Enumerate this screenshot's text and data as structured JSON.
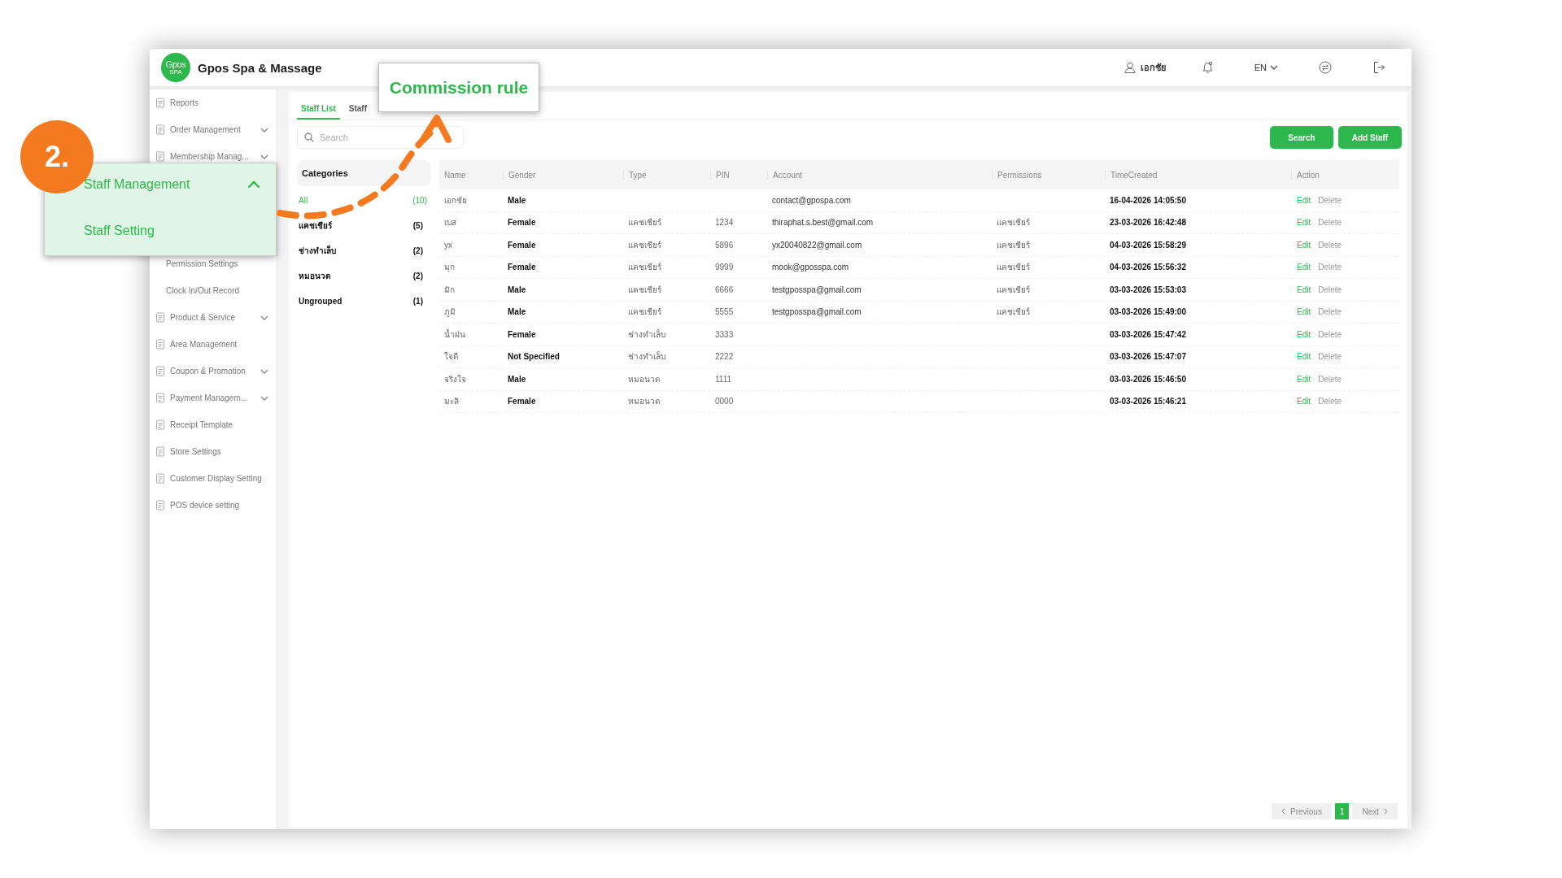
{
  "header": {
    "logo_text": "Gpos",
    "logo_sub": "SPA",
    "brand": "Gpos Spa & Massage",
    "user": "เอกชัย",
    "language": "EN"
  },
  "sidebar": {
    "items_top": [
      {
        "label": "Reports",
        "kind": "item",
        "expandable": false
      },
      {
        "label": "Order Management",
        "kind": "item",
        "expandable": true
      },
      {
        "label": "Membership Manag...",
        "kind": "item",
        "expandable": true
      }
    ],
    "items_bottom": [
      {
        "label": "Permission Settings",
        "kind": "sub",
        "expandable": false
      },
      {
        "label": "Clock In/Out Record",
        "kind": "sub",
        "expandable": false
      },
      {
        "label": "Product & Service",
        "kind": "item",
        "expandable": true
      },
      {
        "label": "Area Management",
        "kind": "item",
        "expandable": false
      },
      {
        "label": "Coupon & Promotion",
        "kind": "item",
        "expandable": true
      },
      {
        "label": "Payment Managem...",
        "kind": "item",
        "expandable": true
      },
      {
        "label": "Receipt Template",
        "kind": "item",
        "expandable": false
      },
      {
        "label": "Store Settings",
        "kind": "item",
        "expandable": false
      },
      {
        "label": "Customer Display Setting",
        "kind": "item",
        "expandable": false
      },
      {
        "label": "POS device setting",
        "kind": "item",
        "expandable": false
      }
    ]
  },
  "sidebar_callout": {
    "step": "2.",
    "title": "Staff Management",
    "expanded": true,
    "subitem": "Staff Setting"
  },
  "commission_callout": {
    "label": "Commission rule"
  },
  "tabs": [
    {
      "label": "Staff List",
      "selected": true
    },
    {
      "label": "Staff",
      "selected": false
    }
  ],
  "search": {
    "placeholder": "Search"
  },
  "buttons": [
    "Search",
    "Add Staff"
  ],
  "categories": {
    "title": "Categories",
    "items": [
      {
        "label": "All",
        "count": "(10)",
        "selected": true
      },
      {
        "label": "แคชเชียร์",
        "count": "(5)",
        "selected": false
      },
      {
        "label": "ช่างทำเล็บ",
        "count": "(2)",
        "selected": false
      },
      {
        "label": "หมอนวด",
        "count": "(2)",
        "selected": false
      },
      {
        "label": "Ungrouped",
        "count": "(1)",
        "selected": false
      }
    ]
  },
  "table": {
    "columns": [
      "Name",
      "Gender",
      "Type",
      "PIN",
      "Account",
      "Permissions",
      "TimeCreated",
      "Action"
    ],
    "rows": [
      {
        "name": "เอกชัย",
        "gender": "Male",
        "type": "",
        "pin": "",
        "account": "contact@gpospa.com",
        "permissions": "",
        "time": "16-04-2026 14:05:50",
        "actions": [
          "Edit",
          "Delete"
        ]
      },
      {
        "name": "เบส",
        "gender": "Female",
        "type": "แคชเชียร์",
        "pin": "1234",
        "account": "thiraphat.s.best@gmail.com",
        "permissions": "แคชเชียร์",
        "time": "23-03-2026 16:42:48",
        "actions": [
          "Edit",
          "Delete"
        ]
      },
      {
        "name": "yx",
        "gender": "Female",
        "type": "แคชเชียร์",
        "pin": "5896",
        "account": "yx20040822@gmail.com",
        "permissions": "แคชเชียร์",
        "time": "04-03-2026 15:58:29",
        "actions": [
          "Edit",
          "Delete"
        ]
      },
      {
        "name": "มุก",
        "gender": "Female",
        "type": "แคชเชียร์",
        "pin": "9999",
        "account": "mook@gposspa.com",
        "permissions": "แคชเชียร์",
        "time": "04-03-2026 15:56:32",
        "actions": [
          "Edit",
          "Delete"
        ]
      },
      {
        "name": "มิก",
        "gender": "Male",
        "type": "แคชเชียร์",
        "pin": "6666",
        "account": "testgposspa@gmail.com",
        "permissions": "แคชเชียร์",
        "time": "03-03-2026 15:53:03",
        "actions": [
          "Edit",
          "Delete"
        ]
      },
      {
        "name": "ภูมิ",
        "gender": "Male",
        "type": "แคชเชียร์",
        "pin": "5555",
        "account": "testgposspa@gmail.com",
        "permissions": "แคชเชียร์",
        "time": "03-03-2026 15:49:00",
        "actions": [
          "Edit",
          "Delete"
        ]
      },
      {
        "name": "น้ำฝน",
        "gender": "Female",
        "type": "ช่างทำเล็บ",
        "pin": "3333",
        "account": "",
        "permissions": "",
        "time": "03-03-2026 15:47:42",
        "actions": [
          "Edit",
          "Delete"
        ]
      },
      {
        "name": "ใจดี",
        "gender": "Not Specified",
        "type": "ช่างทำเล็บ",
        "pin": "2222",
        "account": "",
        "permissions": "",
        "time": "03-03-2026 15:47:07",
        "actions": [
          "Edit",
          "Delete"
        ]
      },
      {
        "name": "จริงใจ",
        "gender": "Male",
        "type": "หมอนวด",
        "pin": "1111",
        "account": "",
        "permissions": "",
        "time": "03-03-2026 15:46:50",
        "actions": [
          "Edit",
          "Delete"
        ]
      },
      {
        "name": "มะลิ",
        "gender": "Female",
        "type": "หมอนวด",
        "pin": "0000",
        "account": "",
        "permissions": "",
        "time": "03-03-2026 15:46:21",
        "actions": [
          "Edit",
          "Delete"
        ]
      }
    ]
  },
  "pagination": {
    "previous": {
      "label": "Previous",
      "disabled": true
    },
    "pages": [
      {
        "label": "1",
        "selected": true
      }
    ],
    "next": {
      "label": "Next",
      "disabled": true
    }
  }
}
